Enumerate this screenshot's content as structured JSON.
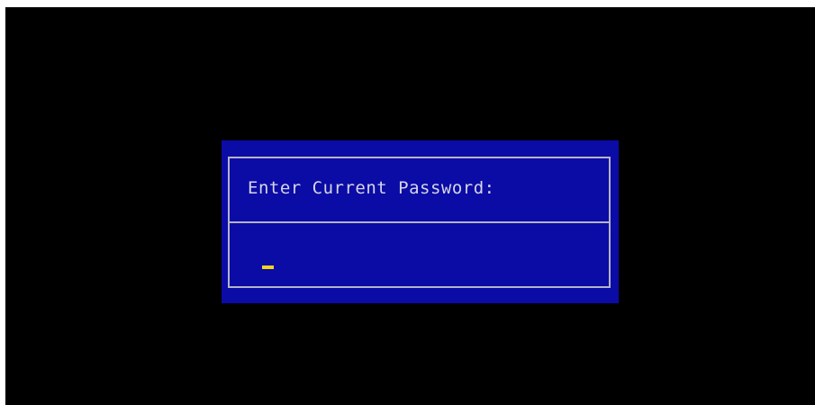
{
  "password_dialog": {
    "prompt": "Enter Current Password:",
    "value": ""
  },
  "colors": {
    "screen_background": "#000000",
    "dialog_background": "#0b0ba6",
    "border": "#b4b4c8",
    "text": "#d6d6e6",
    "cursor": "#f2d51a"
  }
}
